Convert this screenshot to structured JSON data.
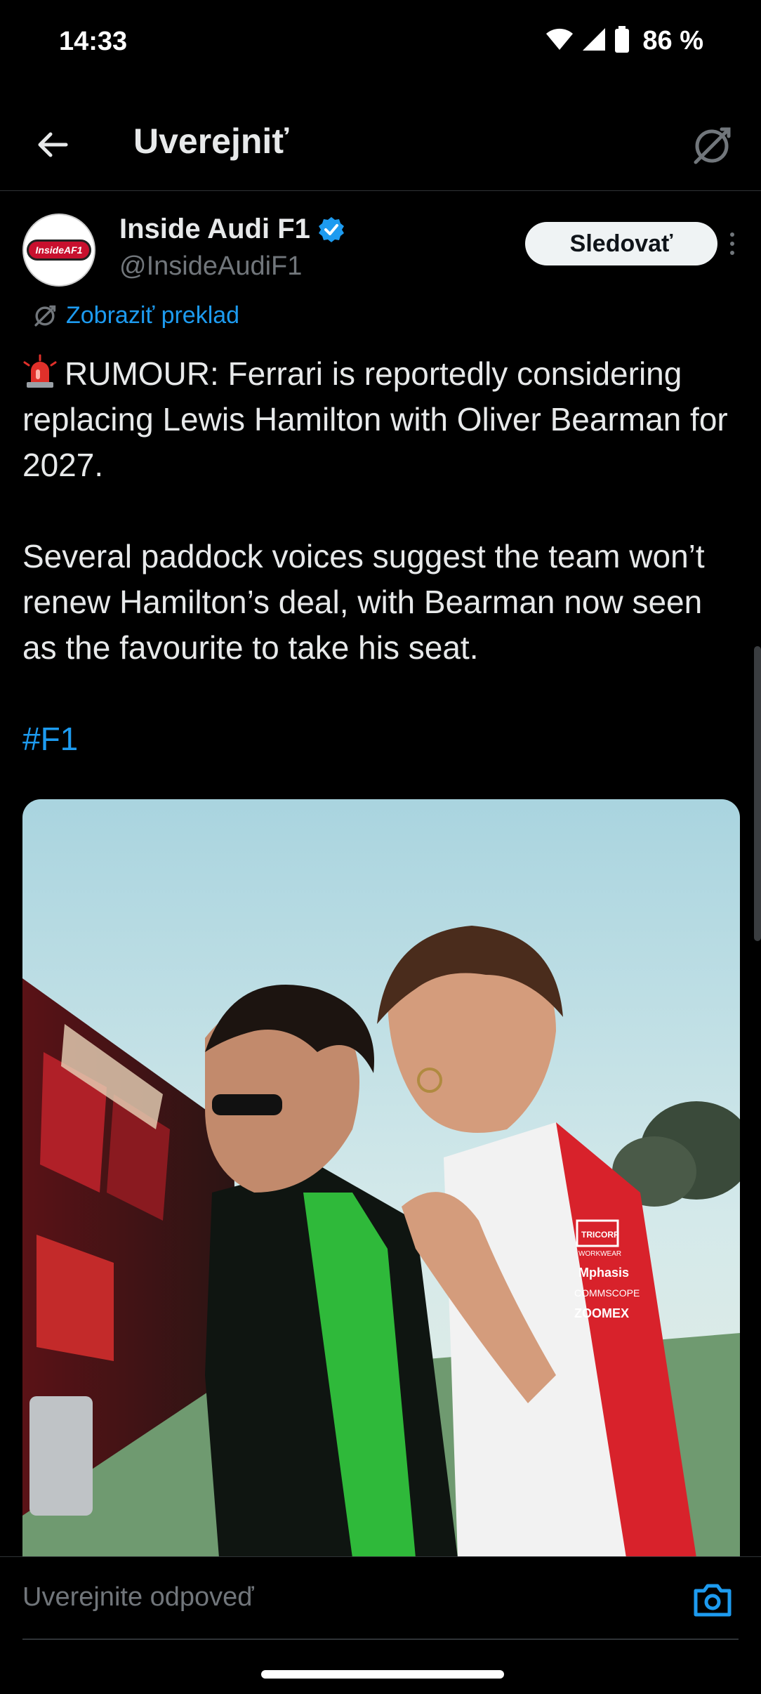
{
  "status_bar": {
    "time": "14:33",
    "battery_percent": "86 %"
  },
  "header": {
    "title": "Uverejniť",
    "back_icon": "arrow-left-icon",
    "translate_icon": "translate-icon"
  },
  "tweet": {
    "author_name": "Inside Audi F1",
    "author_handle": "@InsideAudiF1",
    "avatar_logo_text": "InsideAF1",
    "verified": true,
    "follow_label": "Sledovať",
    "show_translation_label": "Zobraziť preklad",
    "paragraph1": "RUMOUR: Ferrari is reportedly considering replacing Lewis Hamilton with Oliver Bearman for 2027.",
    "paragraph2": "Several paddock voices suggest the team won’t renew Hamilton’s deal, with Bearman now seen as the favourite to take his seat.",
    "hashtag": "#F1"
  },
  "photo": {
    "shirt_sponsors": [
      "TRICORP",
      "WORKWEAR",
      "Mphasis",
      "COMMSCOPE",
      "ZOOMEX"
    ]
  },
  "reply": {
    "placeholder": "Uverejnite odpoveď",
    "camera_icon": "camera-icon"
  },
  "colors": {
    "background": "#000000",
    "accent": "#1d9bf0",
    "text": "#e7e9ea",
    "muted": "#71767b"
  }
}
